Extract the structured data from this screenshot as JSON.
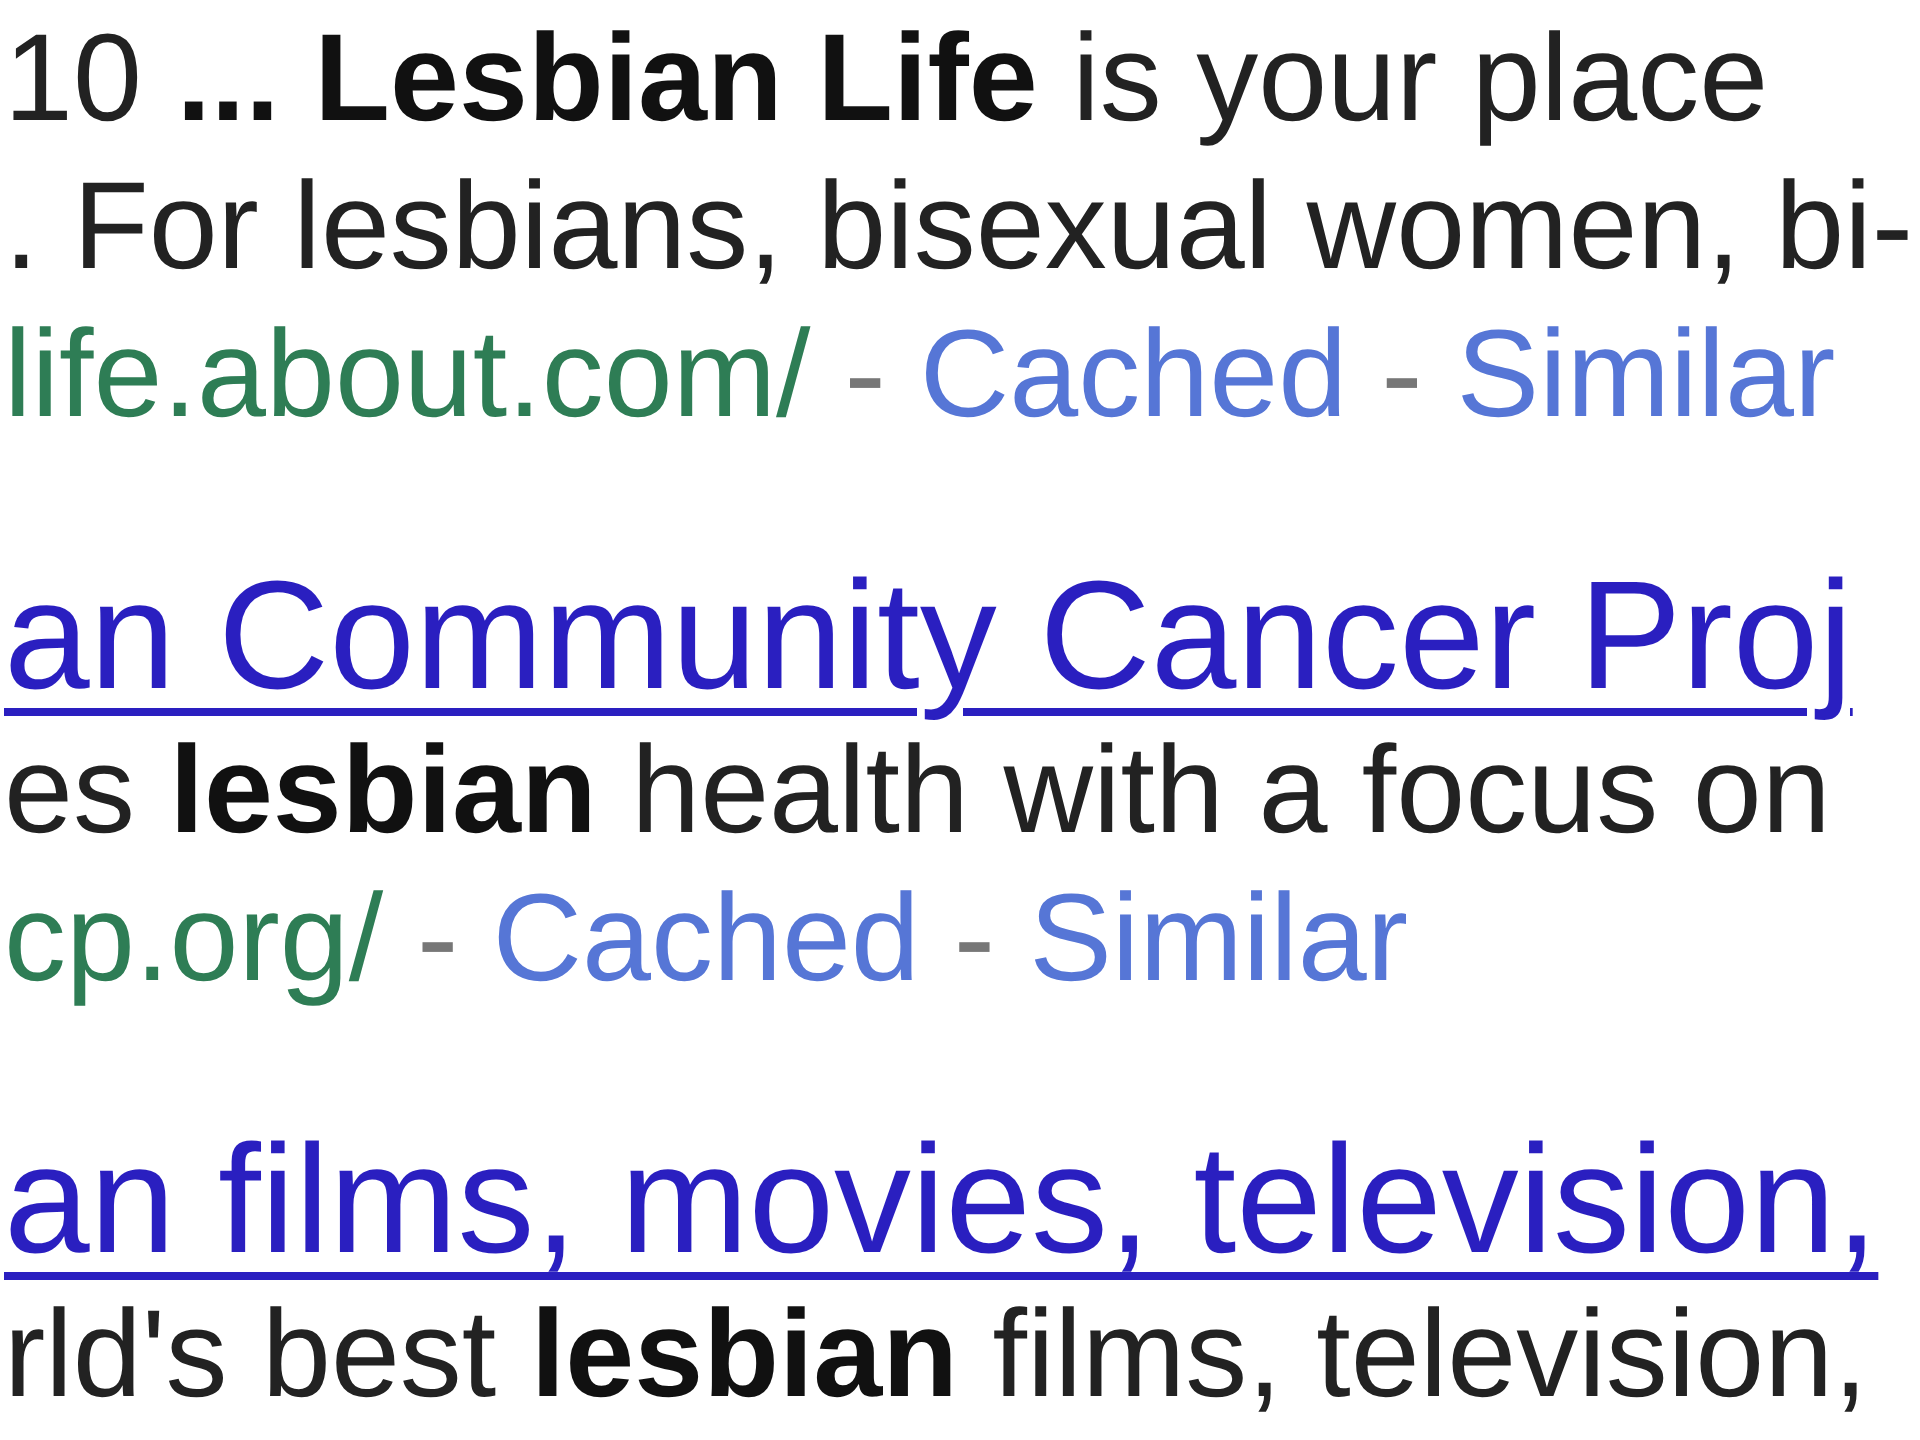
{
  "results": [
    {
      "snippet": [
        "10 **... Lesbian Life** is your place",
        ". For lesbians, bisexual women, bi-"
      ],
      "cite_row": [
        {
          "kind": "url",
          "text": "life.about.com/"
        },
        {
          "kind": "separator",
          "text": "-"
        },
        {
          "kind": "link",
          "text": "Cached"
        },
        {
          "kind": "separator",
          "text": "-"
        },
        {
          "kind": "link",
          "text": "Similar"
        }
      ]
    },
    {
      "title": "an Community Cancer Proj",
      "snippet": [
        "es **lesbian** health with a focus on"
      ],
      "cite_row": [
        {
          "kind": "url",
          "text": "cp.org/"
        },
        {
          "kind": "separator",
          "text": "-"
        },
        {
          "kind": "link",
          "text": "Cached"
        },
        {
          "kind": "separator",
          "text": "-"
        },
        {
          "kind": "link",
          "text": "Similar"
        }
      ]
    },
    {
      "title": "an films, movies, television,",
      "snippet": [
        "rld's best **lesbian** films, television,"
      ]
    }
  ]
}
